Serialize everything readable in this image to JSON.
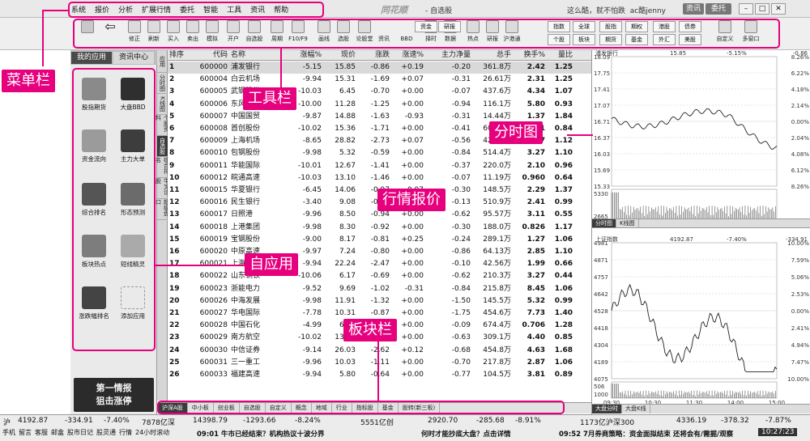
{
  "menubar": {
    "items": [
      "系统",
      "报价",
      "分析",
      "扩展行情",
      "委托",
      "智能",
      "工具",
      "资讯",
      "帮助"
    ],
    "app_title": "同花顺",
    "page_title": "- 自选股",
    "right_text": "这么酷，就不怕跌",
    "user": "ac酷jenny",
    "pill1": "资讯",
    "pill2": "委托"
  },
  "toolbar": {
    "buttons": [
      "修正",
      "刷新",
      "买入",
      "卖出",
      "模拟",
      "开户",
      "自选股",
      "周期",
      "F10/F9",
      "画线",
      "选股",
      "论股堂",
      "资讯",
      "BBD",
      "择时",
      "数据",
      "热点",
      "研报",
      "沪港通"
    ],
    "grid_row1": [
      "资金",
      "研报",
      "指数",
      "全球",
      "股指",
      "期权",
      "港股",
      "债券"
    ],
    "grid_row2": [
      "个股",
      "板块",
      "期货",
      "基金",
      "外汇",
      "美股"
    ],
    "extra": [
      "自定义",
      "多窗口"
    ]
  },
  "leftpanel": {
    "tabs": [
      "我的应用",
      "资讯中心"
    ],
    "apps": [
      "股指期货",
      "大盘BBD",
      "资金流向",
      "主力大单",
      "综合排名",
      "形态预测",
      "板块热点",
      "短线精灵",
      "涨跌幅排名",
      "添加应用"
    ],
    "promo_line1": "第一情报",
    "promo_line2": "狙击涨停"
  },
  "vtabs": [
    "应用",
    "分时图",
    "K线图",
    "个股资料",
    "自选股",
    "综合排名",
    "牛叉诊股",
    "超级盘口"
  ],
  "table": {
    "headers": [
      "排序",
      "代码",
      "名称",
      "涨幅%",
      "现价",
      "涨跌",
      "涨速%",
      "主力净量",
      "总手",
      "换手%",
      "量比"
    ],
    "rows": [
      [
        "1",
        "600000",
        "浦发银行",
        "-5.15",
        "15.85",
        "-0.86",
        "+0.19",
        "-0.20",
        "361.8万",
        "2.42",
        "1.25"
      ],
      [
        "2",
        "600004",
        "白云机场",
        "-9.94",
        "15.31",
        "-1.69",
        "+0.07",
        "-0.31",
        "26.61万",
        "2.31",
        "1.25"
      ],
      [
        "3",
        "600005",
        "武钢股份",
        "-10.03",
        "6.45",
        "-0.70",
        "+0.00",
        "-0.07",
        "437.6万",
        "4.34",
        "1.07"
      ],
      [
        "4",
        "600006",
        "东风汽车",
        "-10.00",
        "11.28",
        "-1.25",
        "+0.00",
        "-0.94",
        "116.1万",
        "5.80",
        "0.93"
      ],
      [
        "5",
        "600007",
        "中国国贸",
        "-9.87",
        "14.88",
        "-1.63",
        "-0.93",
        "-0.31",
        "14.44万",
        "1.37",
        "1.84"
      ],
      [
        "6",
        "600008",
        "首创股份",
        "-10.02",
        "15.36",
        "-1.71",
        "+0.00",
        "-0.41",
        "60.59万",
        "1.81",
        "0.84"
      ],
      [
        "7",
        "600009",
        "上海机场",
        "-8.65",
        "28.82",
        "-2.73",
        "+0.07",
        "-0.56",
        "42.90万",
        "2.87",
        "1.12"
      ],
      [
        "8",
        "600010",
        "包钢股份",
        "-9.98",
        "5.32",
        "-0.59",
        "+0.00",
        "-0.84",
        "514.4万",
        "3.27",
        "1.10"
      ],
      [
        "9",
        "600011",
        "华能国际",
        "-10.01",
        "12.67",
        "-1.41",
        "+0.00",
        "-0.37",
        "220.0万",
        "2.10",
        "0.96"
      ],
      [
        "10",
        "600012",
        "皖通高速",
        "-10.03",
        "13.10",
        "-1.46",
        "+0.00",
        "-0.07",
        "11.19万",
        "0.960",
        "0.64"
      ],
      [
        "11",
        "600015",
        "华夏银行",
        "-6.45",
        "14.06",
        "-0.97",
        "-0.07",
        "-0.30",
        "148.5万",
        "2.29",
        "1.37"
      ],
      [
        "12",
        "600016",
        "民生银行",
        "-3.40",
        "9.08",
        "-0.32",
        "+0.00",
        "-0.13",
        "510.9万",
        "2.41",
        "0.99"
      ],
      [
        "13",
        "600017",
        "日照港",
        "-9.96",
        "8.50",
        "-0.94",
        "+0.00",
        "-0.62",
        "95.57万",
        "3.11",
        "0.55"
      ],
      [
        "14",
        "600018",
        "上港集团",
        "-9.98",
        "8.30",
        "-0.92",
        "+0.00",
        "-0.30",
        "188.0万",
        "0.826",
        "1.17"
      ],
      [
        "15",
        "600019",
        "宝钢股份",
        "-9.00",
        "8.17",
        "-0.81",
        "+0.25",
        "-0.24",
        "289.1万",
        "1.27",
        "1.06"
      ],
      [
        "16",
        "600020",
        "中原高速",
        "-9.97",
        "7.24",
        "-0.80",
        "+0.00",
        "-0.86",
        "64.13万",
        "2.85",
        "1.10"
      ],
      [
        "17",
        "600021",
        "上海电力",
        "-9.94",
        "22.24",
        "-2.47",
        "+0.00",
        "-0.10",
        "42.56万",
        "1.99",
        "0.66"
      ],
      [
        "18",
        "600022",
        "山东钢铁",
        "-10.06",
        "6.17",
        "-0.69",
        "+0.00",
        "-0.62",
        "210.3万",
        "3.27",
        "0.44"
      ],
      [
        "19",
        "600023",
        "浙能电力",
        "-9.52",
        "9.69",
        "-1.02",
        "-0.31",
        "-0.84",
        "215.8万",
        "8.45",
        "1.06"
      ],
      [
        "20",
        "600026",
        "中海发展",
        "-9.98",
        "11.91",
        "-1.32",
        "+0.00",
        "-1.50",
        "145.5万",
        "5.32",
        "0.99"
      ],
      [
        "21",
        "600027",
        "华电国际",
        "-7.78",
        "10.31",
        "-0.87",
        "+0.00",
        "-1.75",
        "454.6万",
        "7.73",
        "1.40"
      ],
      [
        "22",
        "600028",
        "中国石化",
        "-4.99",
        "6.67",
        "-0.35",
        "+0.00",
        "-0.09",
        "674.4万",
        "0.706",
        "1.28"
      ],
      [
        "23",
        "600029",
        "南方航空",
        "-10.02",
        "13.74",
        "-1.53",
        "+0.00",
        "-0.63",
        "309.1万",
        "4.40",
        "0.85"
      ],
      [
        "24",
        "600030",
        "中信证券",
        "-9.14",
        "26.03",
        "-2.62",
        "+0.12",
        "-0.68",
        "454.8万",
        "4.63",
        "1.68"
      ],
      [
        "25",
        "600031",
        "三一重工",
        "-9.96",
        "10.03",
        "-1.11",
        "+0.00",
        "-0.70",
        "217.8万",
        "2.87",
        "1.06"
      ],
      [
        "26",
        "600033",
        "福建高速",
        "-9.94",
        "5.80",
        "-0.64",
        "+0.00",
        "-0.77",
        "104.5万",
        "3.81",
        "0.89"
      ]
    ]
  },
  "bottomtabs": [
    "沪深A股",
    "中小板",
    "创业板",
    "自选股",
    "自定义",
    "概念",
    "地域",
    "行业",
    "指标股",
    "基金",
    "股转(新三板)"
  ],
  "charts": {
    "top": {
      "name": "浦发银行",
      "price": "15.85",
      "pct": "-5.15%",
      "chg": "-0.86",
      "yticks": [
        "18.09",
        "17.75",
        "17.41",
        "17.07",
        "16.71",
        "16.37",
        "16.03",
        "15.69",
        "15.33"
      ],
      "pticks": [
        "8.26%",
        "6.22%",
        "4.18%",
        "2.14%",
        "0.00%",
        "2.04%",
        "4.08%",
        "6.12%",
        "8.26%"
      ],
      "vol": [
        "5330",
        "2665"
      ],
      "xticks": [
        "09:30",
        "10:30",
        "11:30",
        "14:00",
        "15:00"
      ],
      "tabs": [
        "分时图",
        "K线图"
      ]
    },
    "bot": {
      "name": "上证指数",
      "price": "4192.87",
      "pct": "-7.40%",
      "chg": "-334.91",
      "yticks": [
        "4981",
        "4871",
        "4757",
        "4642",
        "4528",
        "4418",
        "4304",
        "4189",
        "4075"
      ],
      "pticks": [
        "10.00%",
        "7.59%",
        "5.06%",
        "2.53%",
        "0.00%",
        "2.41%",
        "4.94%",
        "7.47%",
        "10.00%"
      ],
      "vol": [
        "506",
        "1000"
      ],
      "xticks": [
        "09:30",
        "10:30",
        "11:30",
        "14:00",
        "15:00"
      ],
      "tabs": [
        "大盘分时",
        "大盘K线"
      ]
    }
  },
  "statusbar": {
    "sh": "沪",
    "sh_val": "4192.87",
    "sh_chg": "-334.91",
    "sh_pct": "-7.40%",
    "sh_amt": "7878亿深",
    "sz_val": "14398.79",
    "sz_chg": "-1293.66",
    "sz_pct": "-8.24%",
    "sz_amt": "5551亿创",
    "cy_val": "2920.70",
    "cy_chg": "-285.68",
    "cy_pct": "-8.91%",
    "hs_amt": "1173亿沪深300",
    "hs_val": "4336.19",
    "hs_chg": "-378.32",
    "hs_pct": "-7.87%",
    "links": [
      "手机",
      "留言",
      "客服",
      "邮盒",
      "股市日记",
      "股灵通",
      "行情",
      "24小时滚动"
    ],
    "news1": "09:01 牛市已经结束？机构热议十波分界",
    "news2": "何时才能抄底大盘？点击详情",
    "news3": "09:52 7月券商策略：资金面拟结束 还将会有/需掘/观察",
    "clock": "10:27:23"
  },
  "callouts": {
    "menu": "菜单栏",
    "toolbar": "工具栏",
    "chart": "分时图",
    "quote": "行情报价",
    "app": "自应用",
    "tabs": "板块栏"
  }
}
